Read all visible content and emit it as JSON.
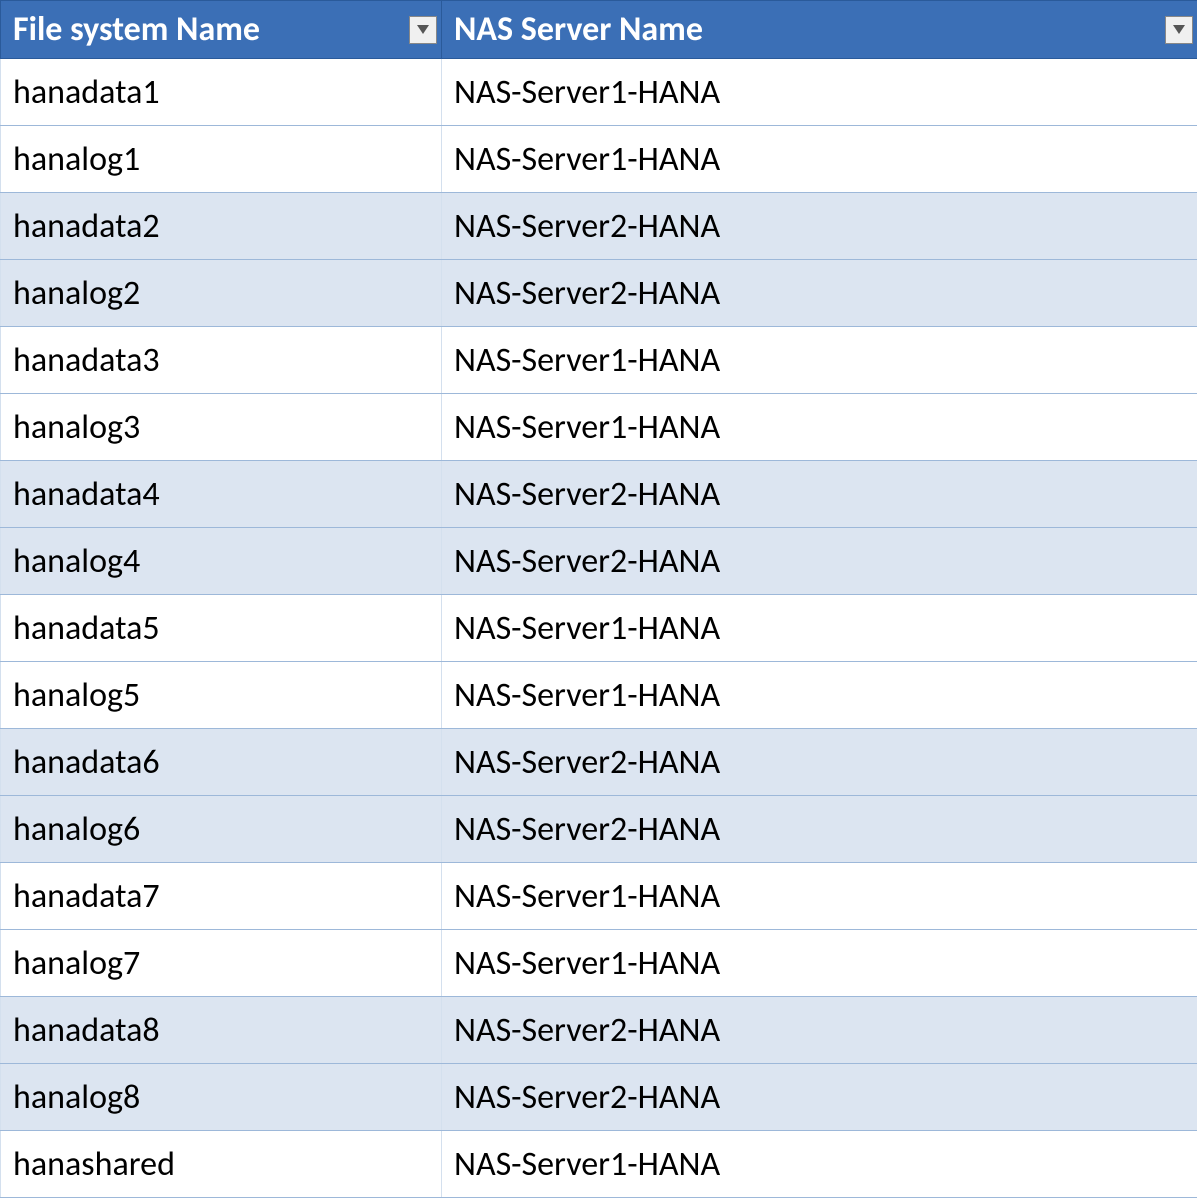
{
  "table": {
    "headers": {
      "filesystem": "File system Name",
      "nasserver": "NAS Server Name"
    },
    "rows": [
      {
        "fs": "hanadata1",
        "nas": "NAS-Server1-HANA",
        "shade": false
      },
      {
        "fs": "hanalog1",
        "nas": "NAS-Server1-HANA",
        "shade": false
      },
      {
        "fs": "hanadata2",
        "nas": "NAS-Server2-HANA",
        "shade": true
      },
      {
        "fs": "hanalog2",
        "nas": "NAS-Server2-HANA",
        "shade": true
      },
      {
        "fs": "hanadata3",
        "nas": "NAS-Server1-HANA",
        "shade": false
      },
      {
        "fs": "hanalog3",
        "nas": "NAS-Server1-HANA",
        "shade": false
      },
      {
        "fs": "hanadata4",
        "nas": "NAS-Server2-HANA",
        "shade": true
      },
      {
        "fs": "hanalog4",
        "nas": "NAS-Server2-HANA",
        "shade": true
      },
      {
        "fs": "hanadata5",
        "nas": "NAS-Server1-HANA",
        "shade": false
      },
      {
        "fs": "hanalog5",
        "nas": "NAS-Server1-HANA",
        "shade": false
      },
      {
        "fs": "hanadata6",
        "nas": "NAS-Server2-HANA",
        "shade": true
      },
      {
        "fs": "hanalog6",
        "nas": "NAS-Server2-HANA",
        "shade": true
      },
      {
        "fs": "hanadata7",
        "nas": "NAS-Server1-HANA",
        "shade": false
      },
      {
        "fs": "hanalog7",
        "nas": "NAS-Server1-HANA",
        "shade": false
      },
      {
        "fs": "hanadata8",
        "nas": "NAS-Server2-HANA",
        "shade": true
      },
      {
        "fs": "hanalog8",
        "nas": "NAS-Server2-HANA",
        "shade": true
      },
      {
        "fs": "hanashared",
        "nas": "NAS-Server1-HANA",
        "shade": false
      }
    ]
  }
}
